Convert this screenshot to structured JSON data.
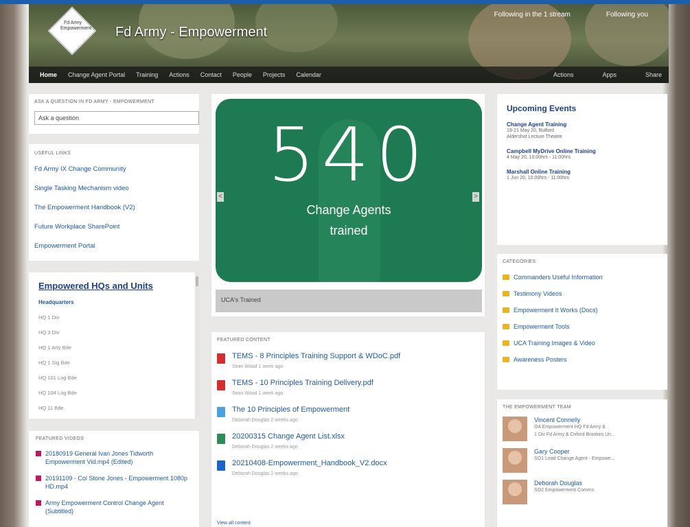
{
  "site": {
    "logo_text": "Fd Army Empowerment",
    "title": "Fd Army - Empowerment",
    "follow_label": "Following in the 1 stream",
    "user_label": "Following you"
  },
  "nav": {
    "items": [
      "Home",
      "Change Agent Portal",
      "Training",
      "Actions",
      "Contact",
      "People",
      "Projects",
      "Calendar"
    ],
    "right": [
      "Actions",
      "Apps",
      "Share"
    ]
  },
  "ask": {
    "title": "ASK A QUESTION IN FD ARMY - EMPOWERMENT",
    "placeholder": "Ask a question"
  },
  "useful_links": {
    "title": "USEFUL LINKS",
    "items": [
      "Fd Army IX Change Community",
      "Single Tasking Mechanism video",
      "The Empowerment Handbook (V2)",
      "Future Workplace SharePoint",
      "Empowerment Portal"
    ]
  },
  "hqs": {
    "title": "Empowered HQs and Units",
    "heading": "Headquarters",
    "items": [
      "HQ 1 Div",
      "HQ 3 Div",
      "HQ 1 Arty Bde",
      "HQ 1 Sig Bde",
      "HQ 101 Log Bde",
      "HQ 104 Log Bde",
      "HQ 11 Bde"
    ]
  },
  "videos": {
    "title": "FEATURED VIDEOS",
    "items": [
      "20180919 General Ivan Jones Tidworth Empowerment Vid.mp4 (Edited)",
      "20191109 - Col Stone Jones - Empowerment 1080p HD.mp4",
      "Army Empowerment Control Change Agent (Subtitled)"
    ]
  },
  "carousel": {
    "number": "540",
    "caption_line1": "Change Agents",
    "caption_line2": "trained",
    "slide_caption": "UCA's Trained",
    "prev": "<",
    "next": ">"
  },
  "features": {
    "title": "FEATURED CONTENT",
    "items": [
      {
        "title": "TEMS - 8 Principles Training Support & WDoC.pdf",
        "meta": "Sean Wood 1 week ago",
        "type": "pdf",
        "color": "#d32f2f"
      },
      {
        "title": "TEMS - 10 Principles Training Delivery.pdf",
        "meta": "Sean Wood 1 week ago",
        "type": "pdf",
        "color": "#d32f2f"
      },
      {
        "title": "The 10 Principles of Empowerment",
        "meta": "Deborah Douglas 2 weeks ago",
        "type": "doc",
        "color": "#4aa3df"
      },
      {
        "title": "20200315 Change Agent List.xlsx",
        "meta": "Deborah Douglas 2 weeks ago",
        "type": "xls",
        "color": "#2e8b57"
      },
      {
        "title": "20210408-Empowerment_Handbook_V2.docx",
        "meta": "Deborah Douglas 2 weeks ago",
        "type": "docx",
        "color": "#1e64c8"
      }
    ],
    "more": "View all content"
  },
  "events": {
    "title": "Upcoming Events",
    "items": [
      {
        "name": "Change Agent Training",
        "line1": "19-21 May 20, Bulford",
        "line2": "Aldershot Lecture Theatre"
      },
      {
        "name": "Campbell MyDrive Online Training",
        "line1": "4 May 20, 10:00hrs - 11:00hrs",
        "line2": ""
      },
      {
        "name": "Marshall Online Training",
        "line1": "1 Jun 20, 10:00hrs - 11:00hrs",
        "line2": ""
      }
    ]
  },
  "categories": {
    "title": "CATEGORIES",
    "items": [
      "Commanders Useful Information",
      "Testimony Videos",
      "Empowerment It Works (Docs)",
      "Empowerment Tools",
      "UCA Training Images & Video",
      "Awareness Posters"
    ]
  },
  "team": {
    "title": "THE EMPOWERMENT TEAM",
    "members": [
      {
        "name": "Vincent Connelly",
        "desc1": "OA Empowerment HQ Fd Army &",
        "desc2": "1 Div Fd Army & Oxford Brookes Un..."
      },
      {
        "name": "Gary Cooper",
        "desc1": "SO1 Lead Change Agent - Empowe...",
        "desc2": ""
      },
      {
        "name": "Deborah Douglas",
        "desc1": "SO2 Empowerment Comms",
        "desc2": ""
      }
    ]
  }
}
